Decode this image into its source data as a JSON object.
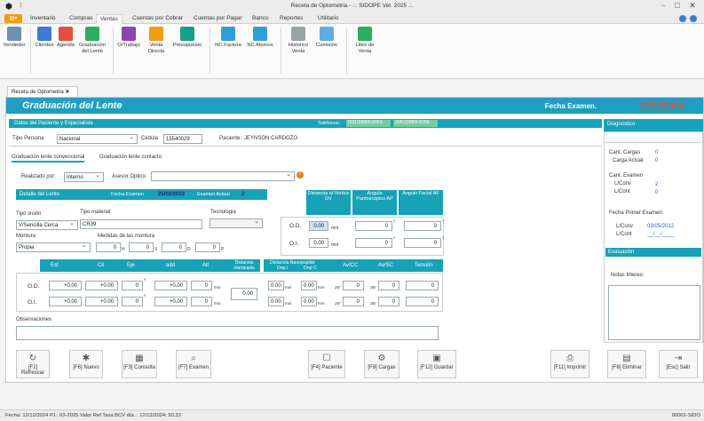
{
  "window": {
    "title": "Receta de Optometria - .:. SIDOPE Ver. 2025 .:.",
    "controls": [
      "⎯",
      "□",
      "✕"
    ]
  },
  "ribbon_tabs": [
    "Inventario",
    "Compras",
    "Ventas",
    "Cuentas por Cobrar",
    "Cuentas por Pagar",
    "Banco",
    "Reportes",
    "Utilitario"
  ],
  "ribbon_buttons": [
    {
      "label": "Vendedor",
      "icon": "vendedor-icon",
      "color": "#6b8fb5"
    },
    {
      "label": "Clientes",
      "icon": "clientes-icon",
      "color": "#3a7bd5"
    },
    {
      "label": "Agenda",
      "icon": "agenda-icon",
      "color": "#e74c3c"
    },
    {
      "label": "Graduación del Lente",
      "icon": "graduacion-icon",
      "color": "#27ae60"
    },
    {
      "label": "O/Trabajo",
      "icon": "otrabajo-icon",
      "color": "#8e44ad"
    },
    {
      "label": "Venta Directa",
      "icon": "venta-icon",
      "color": "#f39c12"
    },
    {
      "label": "Presupuesto",
      "icon": "presupuesto-icon",
      "color": "#16a085"
    },
    {
      "label": "NC Factura",
      "icon": "ncfactura-icon",
      "color": "#2c9fd6"
    },
    {
      "label": "NC Abonos",
      "icon": "ncabonos-icon",
      "color": "#2c9fd6"
    },
    {
      "label": "Historico Venta",
      "icon": "historico-icon",
      "color": "#95a5a6"
    },
    {
      "label": "Comisión",
      "icon": "comision-icon",
      "color": "#5dade2"
    },
    {
      "label": "Libro de Venta",
      "icon": "libro-icon",
      "color": "#27ae60"
    }
  ],
  "doc_tab": {
    "label": "Receta de Optometria",
    "close": "✕"
  },
  "banner": {
    "title": "Graduación del Lente",
    "fecha_label": "Fecha Examen.",
    "fecha_value": "12/12/2024"
  },
  "paciente": {
    "section_title": "Datos del Paciente y Especialista",
    "telefono_label": "Teléfonos:",
    "telefono1": "(0212)9865-0003",
    "telefono2": "(0412)9865-6258",
    "tipo_persona_label": "Tipo Persona",
    "tipo_persona": "Nacional",
    "cedula_label": "Cédula",
    "cedula": "15540029",
    "paciente_label": "Paciente:",
    "paciente": "JEYNSON CARDOZO"
  },
  "subtabs": [
    "Graduación lente convencional",
    "Graduación lente contacto"
  ],
  "realizado": {
    "label": "Realizado por:",
    "value": "Interno",
    "asesor_label": "Asesor Optico:"
  },
  "detalle": {
    "title": "Detalle del Lente",
    "fecha_label": "Fecha Examen",
    "fecha": "25/02/2022",
    "actual_label": "Examen Actual",
    "actual": "2",
    "tipo_vision_label": "Tipo visión",
    "tipo_vision": "V/Sencilla Cerca",
    "tipo_material_label": "Tipo material",
    "tipo_material": "CR39",
    "tecnologia_label": "Tecnologia",
    "montura_label": "Montura",
    "montura": "Propia",
    "medidas_label": "Medidas de las montura",
    "medidas": [
      {
        "value": "0",
        "unit": "H"
      },
      {
        "value": "0",
        "unit": "V"
      },
      {
        "value": "0",
        "unit": "D"
      },
      {
        "value": "0",
        "unit": "P"
      }
    ]
  },
  "vertice": {
    "headers": [
      "Distancia al Vertice DV",
      "Angulo Pantoscopico AP",
      "Angulo Facial AF"
    ],
    "rows": [
      {
        "label": "O.D.",
        "dv": "0.00",
        "dv_unit": "mm",
        "ap": "0",
        "af": "0"
      },
      {
        "label": "O.I.",
        "dv": "0.00",
        "dv_unit": "mm",
        "ap": "0",
        "af": "0"
      }
    ]
  },
  "graduacion": {
    "headers": [
      "Esf",
      "Cil",
      "Eje",
      "add",
      "Alt",
      "Distancia Interpupila",
      "Distancia Nasopupilar",
      "Dnp I",
      "Dnp C",
      "Av/CC",
      "Av/SC",
      "Tensión"
    ],
    "distancia_interpupilar": "0.00",
    "rows": [
      {
        "label": "O.D.",
        "esf": "+0.00",
        "cil": "+0.00",
        "eje": "0",
        "add": "+0.00",
        "alt": "0",
        "dnp_i": "0.00",
        "dnp_c": "0.00",
        "avcc": "0",
        "avsc": "0",
        "tension": "0"
      },
      {
        "label": "O.I.",
        "esf": "+0.00",
        "cil": "+0.00",
        "eje": "0",
        "add": "+0.00",
        "alt": "0",
        "dnp_i": "0.00",
        "dnp_c": "0.00",
        "avcc": "0",
        "avsc": "0",
        "tension": "0"
      }
    ],
    "unit_mm": "mm",
    "unit_20": "20/",
    "degree": "°"
  },
  "observaciones_label": "Observaciones",
  "diagnostico": {
    "title": "Diagnóstico",
    "cant_cargas_label": "Cant. Cargas",
    "cant_cargas": "0",
    "carga_actual_label": "Carga Actual",
    "carga_actual": "0",
    "cant_examen_label": "Cant. Examen",
    "lconv_label": "L/Conv",
    "lconv": "2",
    "lcont_label": "L/Cont",
    "lcont": "0",
    "fecha_primer_label": "Fecha Primer Examen:",
    "fp_lconv_label": "L/Conv",
    "fp_lconv": "03/05/2012",
    "fp_lcont_label": "L/Cont",
    "fp_lcont": "__/__/____",
    "evaluacion_label": "Evaluación",
    "notas_label": "Notas Interes:"
  },
  "buttons": [
    {
      "label": "[F2] Refrescar",
      "icon": "refresh-icon",
      "glyph": "↻"
    },
    {
      "label": "[F6] Nuevo",
      "icon": "nuevo-icon",
      "glyph": "✱"
    },
    {
      "label": "[F3] Consulta",
      "icon": "consulta-icon",
      "glyph": "▦"
    },
    {
      "label": "[F7] Examen",
      "icon": "examen-icon",
      "glyph": "⌕"
    },
    {
      "label": "[F4] Paciente",
      "icon": "paciente-icon",
      "glyph": "☐"
    },
    {
      "label": "[F9] Cargas",
      "icon": "cargas-icon",
      "glyph": "⚙"
    },
    {
      "label": "[F12] Guardar",
      "icon": "guardar-icon",
      "glyph": "▣"
    },
    {
      "label": "[F11] Imprimir",
      "icon": "imprimir-icon",
      "glyph": "⎙"
    },
    {
      "label": "[F8] Eliminar",
      "icon": "eliminar-icon",
      "glyph": "▤"
    },
    {
      "label": "[Esc] Salir",
      "icon": "salir-icon",
      "glyph": "⇥"
    }
  ],
  "status": {
    "text": "Fecha:  12/12/2024   P.I.: 03-2025   Valor Ref Tasa BCV día .: 12/12/2024: 50.33",
    "right": "00001-SIDO"
  }
}
